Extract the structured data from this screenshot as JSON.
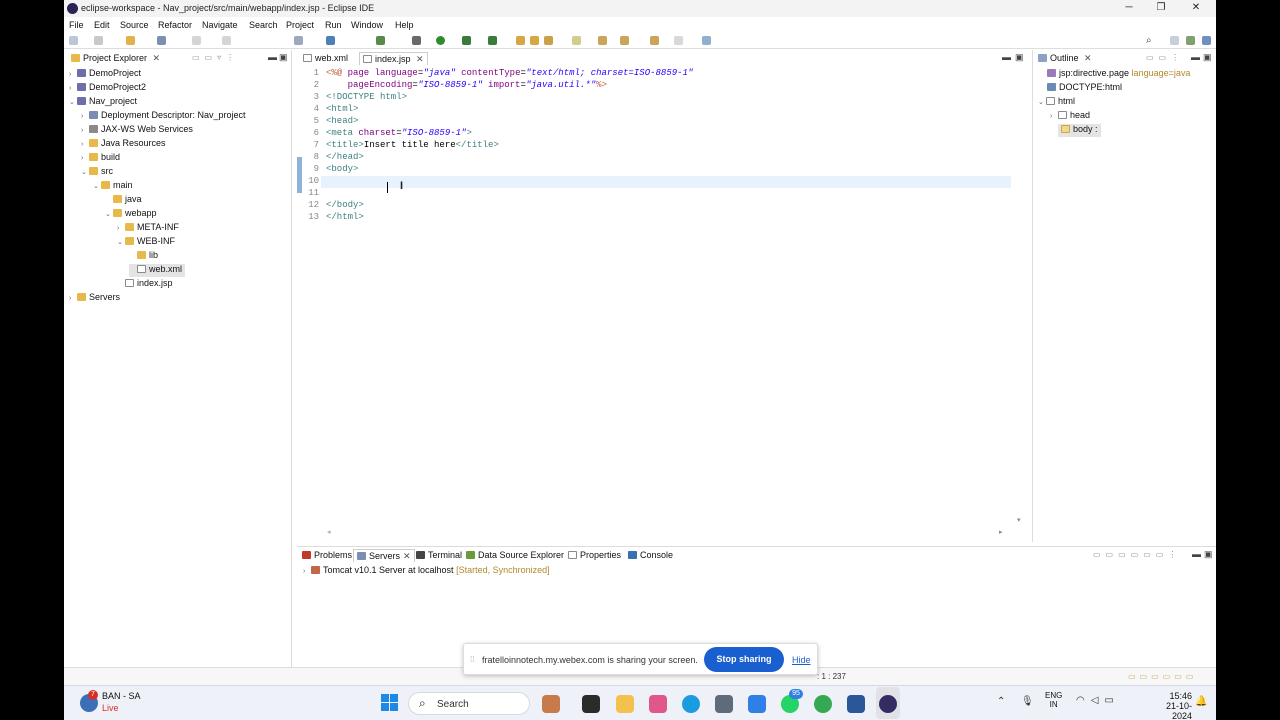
{
  "window": {
    "title": "eclipse-workspace - Nav_project/src/main/webapp/index.jsp - Eclipse IDE"
  },
  "menu": [
    "File",
    "Edit",
    "Source",
    "Refactor",
    "Navigate",
    "Search",
    "Project",
    "Run",
    "Window",
    "Help"
  ],
  "project_explorer": {
    "title": "Project Explorer",
    "items": [
      "DemoProject",
      "DemoProject2",
      "Nav_project",
      "Deployment Descriptor: Nav_project",
      "JAX-WS Web Services",
      "Java Resources",
      "build",
      "src",
      "main",
      "java",
      "webapp",
      "META-INF",
      "WEB-INF",
      "lib",
      "web.xml",
      "index.jsp",
      "Servers"
    ]
  },
  "editor": {
    "tabs": [
      "web.xml",
      "index.jsp"
    ],
    "lines": [
      {
        "n": "1",
        "segs": [
          [
            "dir",
            "<%@ "
          ],
          [
            "attr",
            "page "
          ],
          [
            "attr",
            "language"
          ],
          [
            "txt",
            "="
          ],
          [
            "str",
            "\"java\""
          ],
          [
            "txt",
            " "
          ],
          [
            "attr",
            "contentType"
          ],
          [
            "txt",
            "="
          ],
          [
            "str",
            "\"text/html; charset=ISO-8859-1\""
          ]
        ]
      },
      {
        "n": "2",
        "segs": [
          [
            "txt",
            "    "
          ],
          [
            "attr",
            "pageEncoding"
          ],
          [
            "txt",
            "="
          ],
          [
            "str",
            "\"ISO-8859-1\""
          ],
          [
            "txt",
            " "
          ],
          [
            "attr",
            "import"
          ],
          [
            "txt",
            "="
          ],
          [
            "str",
            "\"java.util.*\""
          ],
          [
            "dir",
            "%>"
          ]
        ]
      },
      {
        "n": "3",
        "segs": [
          [
            "tag",
            "<!DOCTYPE html>"
          ]
        ]
      },
      {
        "n": "4",
        "segs": [
          [
            "tag",
            "<html>"
          ]
        ]
      },
      {
        "n": "5",
        "segs": [
          [
            "tag",
            "<head>"
          ]
        ]
      },
      {
        "n": "6",
        "segs": [
          [
            "tag",
            "<meta "
          ],
          [
            "attr",
            "charset"
          ],
          [
            "txt",
            "="
          ],
          [
            "str",
            "\"ISO-8859-1\""
          ],
          [
            "tag",
            ">"
          ]
        ]
      },
      {
        "n": "7",
        "segs": [
          [
            "tag",
            "<title>"
          ],
          [
            "txt",
            "Insert title here"
          ],
          [
            "tag",
            "</title>"
          ]
        ]
      },
      {
        "n": "8",
        "segs": [
          [
            "tag",
            "</head>"
          ]
        ]
      },
      {
        "n": "9",
        "segs": [
          [
            "tag",
            "<body>"
          ]
        ]
      },
      {
        "n": "10",
        "segs": []
      },
      {
        "n": "11",
        "segs": []
      },
      {
        "n": "12",
        "segs": [
          [
            "tag",
            "</body>"
          ]
        ]
      },
      {
        "n": "13",
        "segs": [
          [
            "tag",
            "</html>"
          ]
        ]
      }
    ]
  },
  "outline": {
    "title": "Outline",
    "directive": "jsp:directive.page",
    "directive_attr": "language=java",
    "items": [
      "DOCTYPE:html",
      "html",
      "head",
      "body"
    ]
  },
  "bottom_panel": {
    "tabs": [
      "Problems",
      "Servers",
      "Terminal",
      "Data Source Explorer",
      "Properties",
      "Console"
    ],
    "server_name": "Tomcat v10.1 Server at localhost",
    "server_status": "[Started, Synchronized]"
  },
  "webex": {
    "message": "fratelloinnotech.my.webex.com is sharing your screen.",
    "stop_label": "Stop sharing",
    "hide_label": "Hide"
  },
  "status": {
    "position": ": 1 : 237"
  },
  "taskbar": {
    "match": "BAN - SA",
    "live": "Live",
    "live_badge": "7",
    "search": "Search",
    "whatsapp_badge": "95",
    "lang1": "ENG",
    "lang2": "IN",
    "time": "15:46",
    "date": "21-10-2024"
  },
  "colors": {
    "accent": "#1a5fd0",
    "selection": "#d9e6f5"
  }
}
